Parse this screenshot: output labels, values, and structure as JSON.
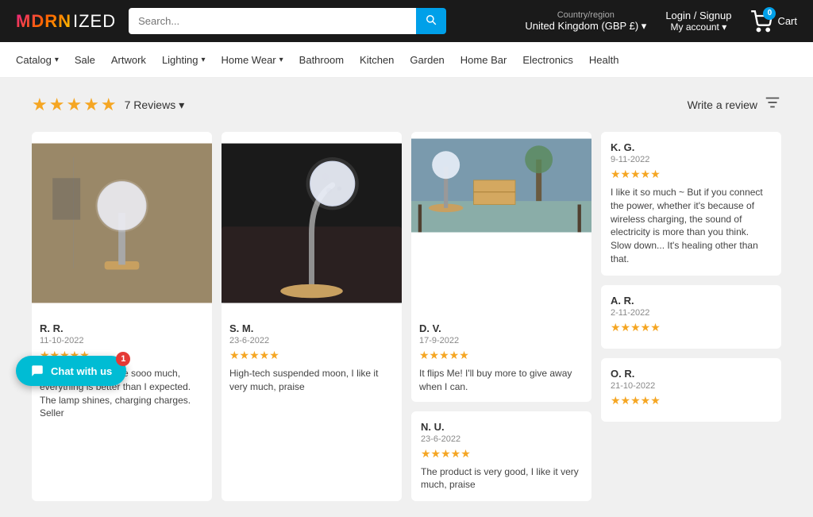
{
  "header": {
    "logo_mdrn": "MDRN",
    "logo_ized": "IZED",
    "search_placeholder": "Search...",
    "search_btn_icon": "🔍",
    "country_label": "Country/region",
    "country_value": "United Kingdom (GBP £)",
    "login_label": "Login / Signup",
    "account_label": "My account",
    "cart_count": "0",
    "cart_label": "Cart"
  },
  "nav": {
    "items": [
      {
        "label": "Catalog",
        "has_dropdown": true
      },
      {
        "label": "Sale",
        "has_dropdown": false
      },
      {
        "label": "Artwork",
        "has_dropdown": false
      },
      {
        "label": "Lighting",
        "has_dropdown": true
      },
      {
        "label": "Home Wear",
        "has_dropdown": true
      },
      {
        "label": "Bathroom",
        "has_dropdown": false
      },
      {
        "label": "Kitchen",
        "has_dropdown": false
      },
      {
        "label": "Garden",
        "has_dropdown": false
      },
      {
        "label": "Home Bar",
        "has_dropdown": false
      },
      {
        "label": "Electronics",
        "has_dropdown": false
      },
      {
        "label": "Health",
        "has_dropdown": false
      }
    ]
  },
  "reviews_section": {
    "stars_display": "★★★★★",
    "review_count_text": "7 Reviews",
    "write_review_label": "Write a review",
    "filter_icon": "≡",
    "reviews": [
      {
        "id": "rr",
        "name": "R. R.",
        "date": "11-10-2022",
        "stars": "★★★★★",
        "text": "It's just a bomb! I like sooo much, everything is better than I expected. The lamp shines, charging charges. Seller",
        "has_photo": true,
        "photo_type": "warm-lamp"
      },
      {
        "id": "sm",
        "name": "S. M.",
        "date": "23-6-2022",
        "stars": "★★★★★",
        "text": "High-tech suspended moon, I like it very much, praise",
        "has_photo": true,
        "photo_type": "dark-lamp"
      },
      {
        "id": "dv",
        "name": "D. V.",
        "date": "17-9-2022",
        "stars": "★★★★★",
        "text": "It flips Me! I'll buy more to give away when I can.",
        "has_photo": true,
        "photo_type": "desk-lamp"
      },
      {
        "id": "kg",
        "name": "K. G.",
        "date": "9-11-2022",
        "stars": "★★★★★",
        "text": "I like it so much ~ But if you connect the power, whether it's because of wireless charging, the sound of electricity is more than you think. Slow down... It's healing other than that.",
        "has_photo": false
      },
      {
        "id": "nu",
        "name": "N. U.",
        "date": "23-6-2022",
        "stars": "★★★★★",
        "text": "The product is very good, I like it very much, praise",
        "has_photo": false
      },
      {
        "id": "ar",
        "name": "A. R.",
        "date": "2-11-2022",
        "stars": "★★★★★",
        "text": "",
        "has_photo": false
      },
      {
        "id": "or",
        "name": "O. R.",
        "date": "21-10-2022",
        "stars": "★★★★★",
        "text": "",
        "has_photo": false
      }
    ]
  },
  "chat": {
    "label": "Chat with us",
    "badge": "1"
  }
}
